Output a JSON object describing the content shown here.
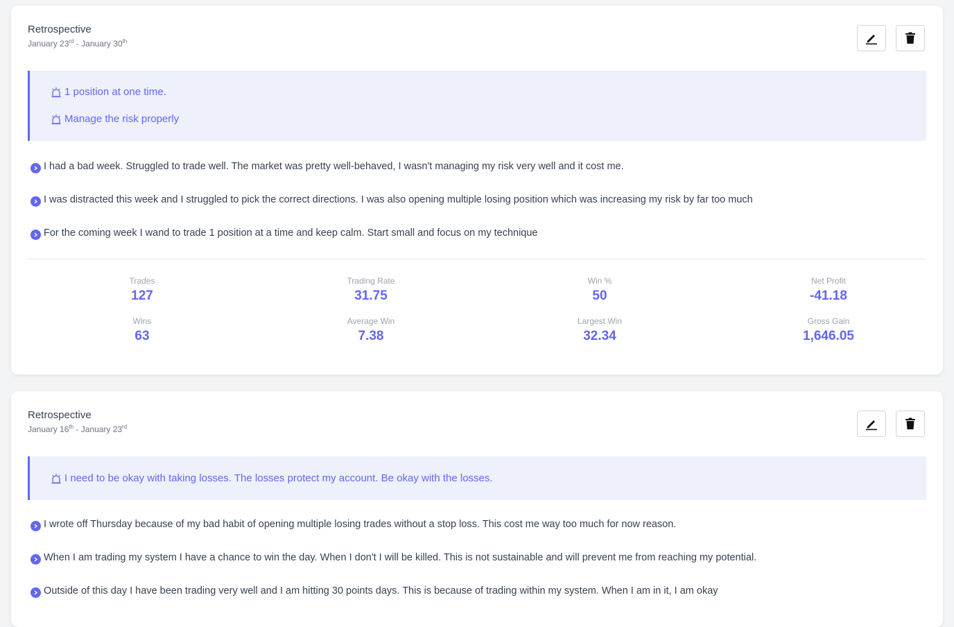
{
  "colors": {
    "accent": "#6366f1",
    "goal_bg": "#eef0fb",
    "text": "#374151",
    "muted": "#6b7280"
  },
  "cards": [
    {
      "title": "Retrospective",
      "start_month": "January 23",
      "start_sup": "rd",
      "separator": " - ",
      "end_month": "January 30",
      "end_sup": "th",
      "edit_icon": "pencil-icon",
      "delete_icon": "trash-icon",
      "goal_icon": "alarm-icon",
      "goals": [
        "1 position at one time.",
        "Manage the risk properly"
      ],
      "notes": [
        "I had a bad week. Struggled to trade well. The market was pretty well-behaved, I wasn't managing my risk very well and it cost me.",
        "I was distracted this week and I struggled to pick the correct directions. I was also opening multiple losing position which was increasing my risk by far too much",
        "For the coming week I wand to trade 1 position at a time and keep calm. Start small and focus on my technique"
      ],
      "stats": [
        {
          "label": "Trades",
          "value": "127"
        },
        {
          "label": "Trading Rate",
          "value": "31.75"
        },
        {
          "label": "Win %",
          "value": "50"
        },
        {
          "label": "Net Profit",
          "value": "-41.18"
        },
        {
          "label": "Wins",
          "value": "63"
        },
        {
          "label": "Average Win",
          "value": "7.38"
        },
        {
          "label": "Largest Win",
          "value": "32.34"
        },
        {
          "label": "Gross Gain",
          "value": "1,646.05"
        }
      ]
    },
    {
      "title": "Retrospective",
      "start_month": "January 16",
      "start_sup": "th",
      "separator": " - ",
      "end_month": "January 23",
      "end_sup": "rd",
      "edit_icon": "pencil-icon",
      "delete_icon": "trash-icon",
      "goal_icon": "alarm-icon",
      "goals": [
        "I need to be okay with taking losses. The losses protect my account. Be okay with the losses."
      ],
      "notes": [
        "I wrote off Thursday because of my bad habit of opening multiple losing trades without a stop loss. This cost me way too much for now reason.",
        "When I am trading my system I have a chance to win the day. When I don't I will be killed. This is not sustainable and will prevent me from reaching my potential.",
        "Outside of this day I have been trading very well and I am hitting 30 points days. This is because of trading within my system. When I am in it, I am okay"
      ]
    }
  ]
}
